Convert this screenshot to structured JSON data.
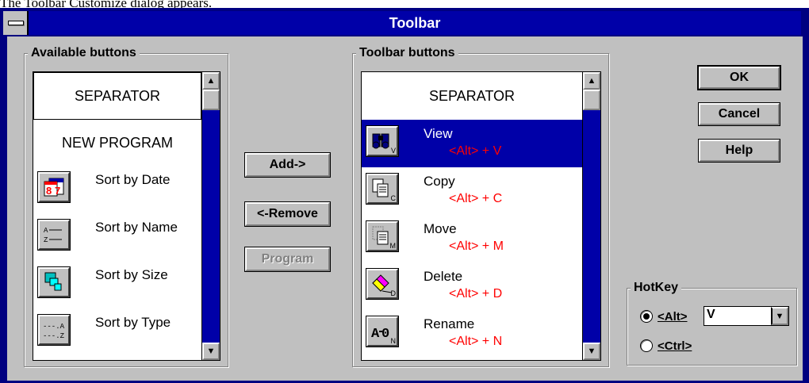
{
  "caption": "The Toolbar Customize dialog appears.",
  "window": {
    "title": "Toolbar"
  },
  "available": {
    "label": "Available buttons",
    "separator": "SEPARATOR",
    "new_program": "NEW PROGRAM",
    "items": [
      {
        "label": "Sort by Date",
        "icon": "calendar-icon"
      },
      {
        "label": "Sort by Name",
        "icon": "sort-name-icon"
      },
      {
        "label": "Sort by Size",
        "icon": "sort-size-icon"
      },
      {
        "label": "Sort by Type",
        "icon": "sort-type-icon"
      }
    ]
  },
  "toolbar_list": {
    "label": "Toolbar buttons",
    "separator": "SEPARATOR",
    "items": [
      {
        "label": "View",
        "hotkey": "<Alt> + V",
        "sub": "V",
        "icon": "binoculars-icon",
        "selected": true
      },
      {
        "label": "Copy",
        "hotkey": "<Alt> + C",
        "sub": "C",
        "icon": "copy-icon",
        "selected": false
      },
      {
        "label": "Move",
        "hotkey": "<Alt> + M",
        "sub": "M",
        "icon": "move-icon",
        "selected": false
      },
      {
        "label": "Delete",
        "hotkey": "<Alt> + D",
        "sub": "D",
        "icon": "eraser-icon",
        "selected": false
      },
      {
        "label": "Rename",
        "hotkey": "<Alt> + N",
        "sub": "N",
        "icon": "rename-icon",
        "selected": false
      }
    ]
  },
  "actions": {
    "add": "Add->",
    "remove": "<-Remove",
    "program": "Program"
  },
  "buttons": {
    "ok": "OK",
    "cancel": "Cancel",
    "help": "Help"
  },
  "hotkey": {
    "label": "HotKey",
    "alt_label": "<Alt>",
    "ctrl_label": "<Ctrl>",
    "selected_modifier": "alt",
    "value": "V"
  },
  "colors": {
    "title_bar": "#0000a8",
    "selection": "#0000a8",
    "hotkey_text": "#ff0000",
    "face": "#c0c0c0"
  }
}
